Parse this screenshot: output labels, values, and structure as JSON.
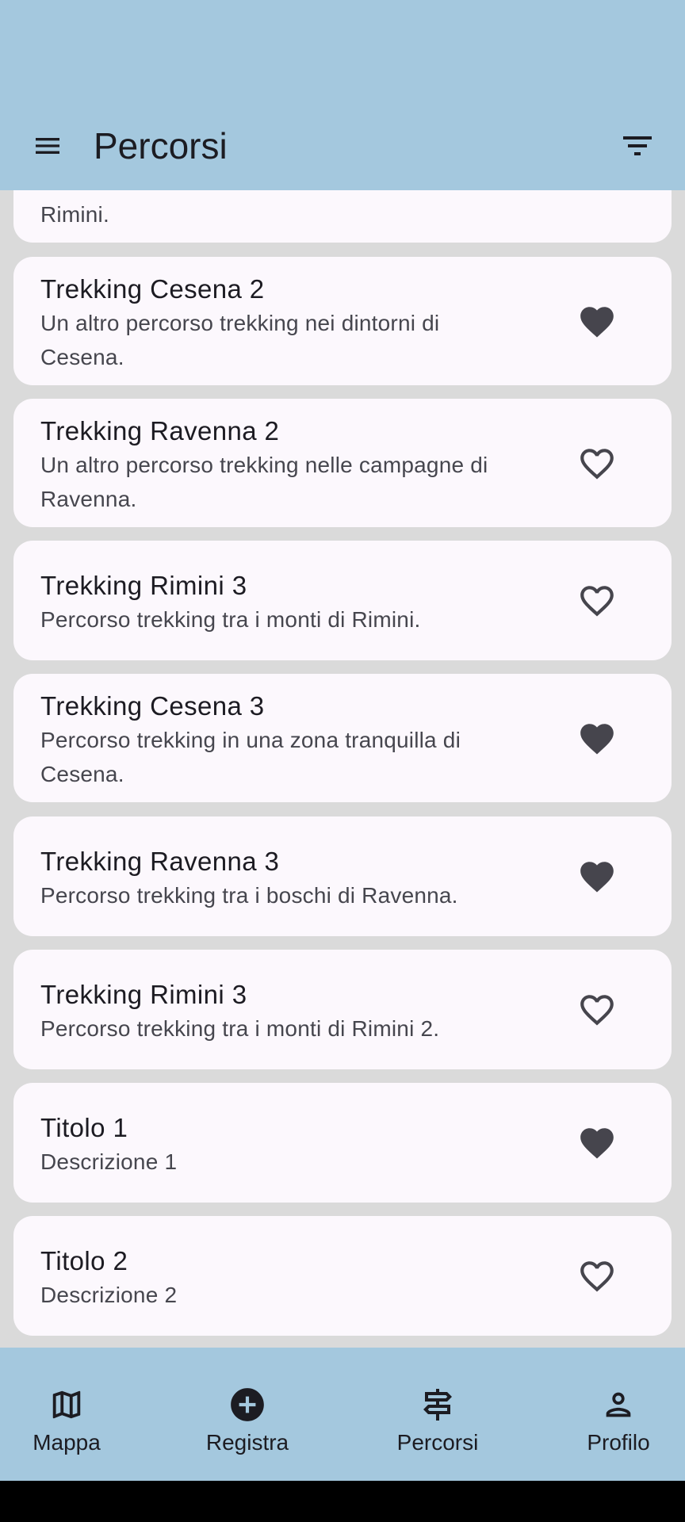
{
  "topbar": {
    "title": "Percorsi"
  },
  "routes": [
    {
      "title": "",
      "description": "Rimini.",
      "favorite": true
    },
    {
      "title": "Trekking Cesena 2",
      "description": "Un altro percorso trekking nei dintorni di Cesena.",
      "favorite": true
    },
    {
      "title": "Trekking Ravenna 2",
      "description": "Un altro percorso trekking nelle campagne di Ravenna.",
      "favorite": false
    },
    {
      "title": "Trekking Rimini 3",
      "description": "Percorso trekking tra i monti di Rimini.",
      "favorite": false
    },
    {
      "title": "Trekking Cesena 3",
      "description": "Percorso trekking in una zona tranquilla di Cesena.",
      "favorite": true
    },
    {
      "title": "Trekking Ravenna 3",
      "description": "Percorso trekking tra i boschi di Ravenna.",
      "favorite": true
    },
    {
      "title": "Trekking Rimini 3",
      "description": "Percorso trekking tra i monti di Rimini 2.",
      "favorite": false
    },
    {
      "title": "Titolo 1",
      "description": "Descrizione 1",
      "favorite": true
    },
    {
      "title": "Titolo 2",
      "description": "Descrizione 2",
      "favorite": false
    }
  ],
  "bottom_nav": [
    {
      "label": "Mappa",
      "icon": "map-icon"
    },
    {
      "label": "Registra",
      "icon": "add-circle-icon"
    },
    {
      "label": "Percorsi",
      "icon": "signpost-icon"
    },
    {
      "label": "Profilo",
      "icon": "person-icon"
    }
  ],
  "colors": {
    "bar": "#a4c8de",
    "card": "#fcf8fd",
    "background": "#dadada",
    "icon": "#46454d"
  }
}
